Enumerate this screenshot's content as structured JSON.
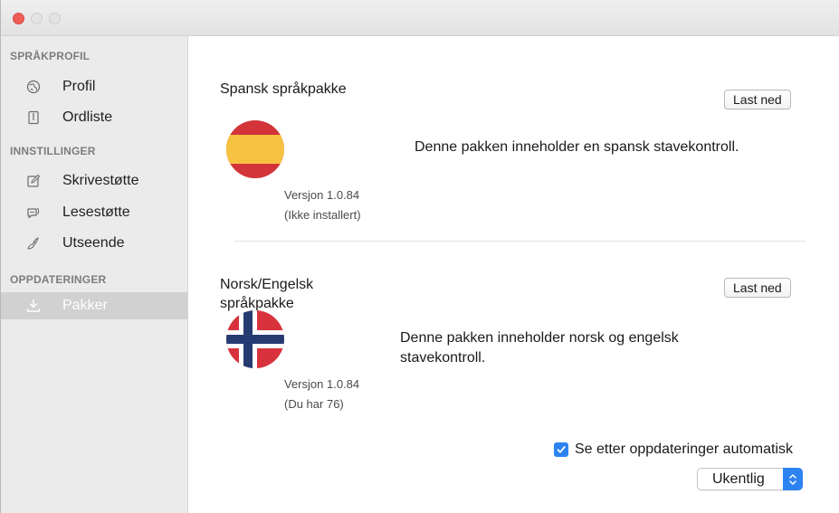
{
  "sidebar": {
    "sections": [
      {
        "header": "SPRÅKPROFIL",
        "items": [
          {
            "label": "Profil",
            "icon": "globe-icon"
          },
          {
            "label": "Ordliste",
            "icon": "book-icon"
          }
        ]
      },
      {
        "header": "INNSTILLINGER",
        "items": [
          {
            "label": "Skrivestøtte",
            "icon": "pencil-icon"
          },
          {
            "label": "Lesestøtte",
            "icon": "speech-bubble-icon"
          },
          {
            "label": "Utseende",
            "icon": "brush-icon"
          }
        ]
      },
      {
        "header": "OPPDATERINGER",
        "items": [
          {
            "label": "Pakker",
            "icon": "download-icon",
            "selected": true
          }
        ]
      }
    ]
  },
  "packages": [
    {
      "title": "Spansk språkpakke",
      "button": "Last ned",
      "flag": "spain-flag-icon",
      "version": "Versjon 1.0.84",
      "status": "(Ikke installert)",
      "description": "Denne pakken inneholder en spansk stavekontroll."
    },
    {
      "title_line1": "Norsk/Engelsk",
      "title_line2": "språkpakke",
      "button": "Last ned",
      "flag": "norway-flag-icon",
      "version": "Versjon 1.0.84",
      "status": "(Du har  76)",
      "description_line1": "Denne pakken inneholder norsk og engelsk",
      "description_line2": "stavekontroll."
    }
  ],
  "updates": {
    "auto_check_label": "Se etter oppdateringer automatisk",
    "auto_check_checked": true,
    "frequency_selected": "Ukentlig"
  },
  "colors": {
    "accent": "#2d83f0",
    "close": "#ee5e57",
    "sidebar_bg": "#ebebeb",
    "selected_bg": "#d1d1d1"
  }
}
